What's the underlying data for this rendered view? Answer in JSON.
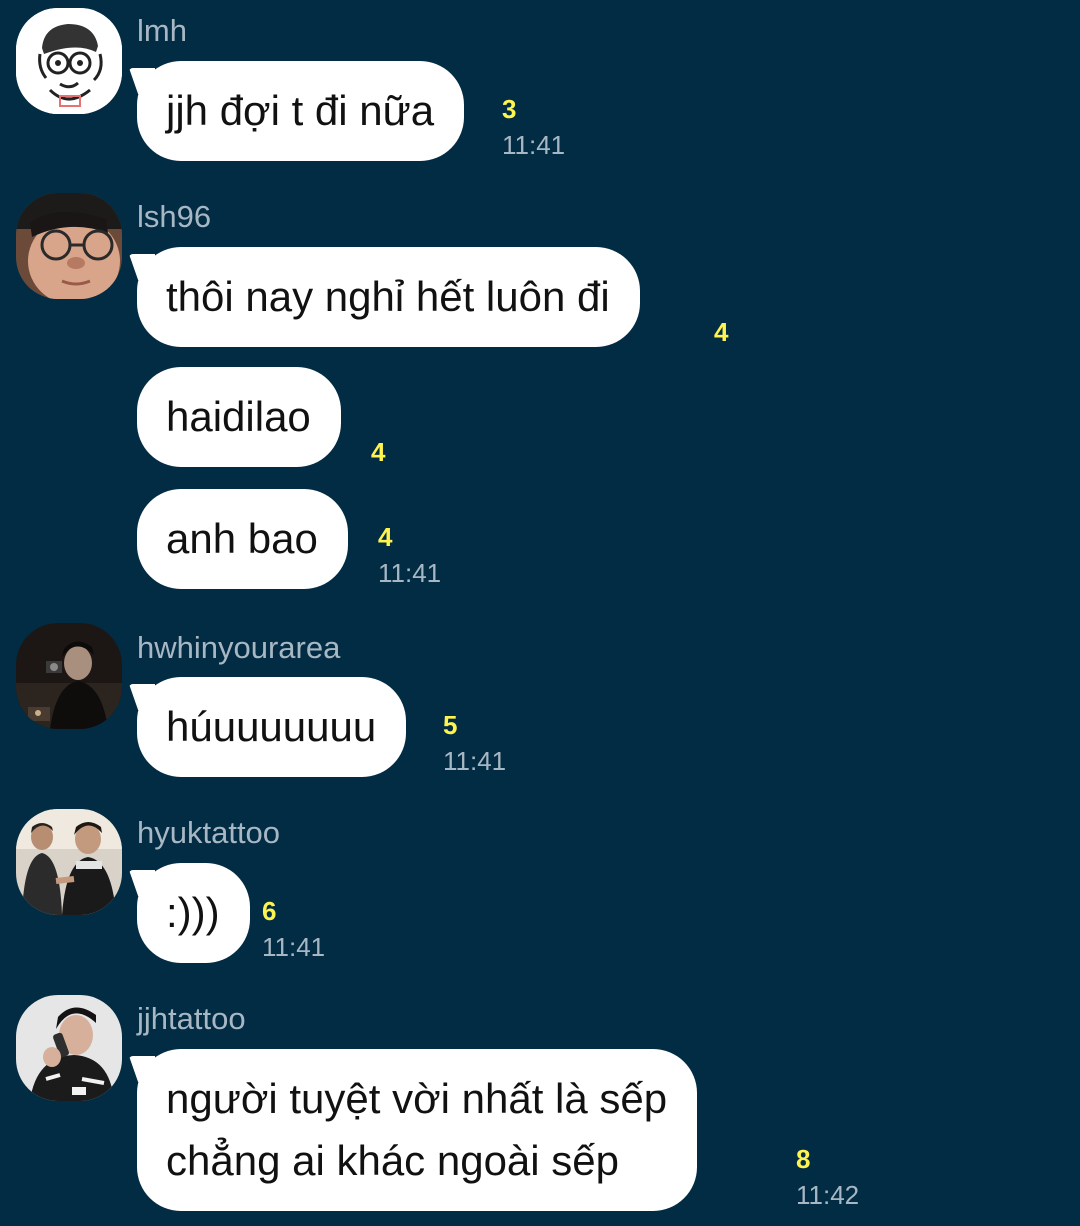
{
  "colors": {
    "background": "#022c43",
    "bubble": "#ffffff",
    "unread_count": "#fff44f",
    "meta_text": "#a7b7c3"
  },
  "messages": [
    {
      "sender": "lmh",
      "avatar": "cartoon-avatar",
      "bubbles": [
        {
          "text": "jjh đợi t đi nữa",
          "unread": "3",
          "time": "11:41"
        }
      ]
    },
    {
      "sender": "lsh96",
      "avatar": "glasses-photo-avatar",
      "bubbles": [
        {
          "text": "thôi nay nghỉ hết luôn đi",
          "unread": "4"
        },
        {
          "text": "haidilao",
          "unread": "4"
        },
        {
          "text": "anh bao",
          "unread": "4",
          "time": "11:41"
        }
      ]
    },
    {
      "sender": "hwhinyourarea",
      "avatar": "dark-photo-avatar",
      "bubbles": [
        {
          "text": "húuuuuuuu",
          "unread": "5",
          "time": "11:41"
        }
      ]
    },
    {
      "sender": "hyuktattoo",
      "avatar": "group-photo-avatar",
      "bubbles": [
        {
          "text": ":)))",
          "unread": "6",
          "time": "11:41"
        }
      ]
    },
    {
      "sender": "jjhtattoo",
      "avatar": "phone-photo-avatar",
      "bubbles": [
        {
          "lines": [
            "người tuyệt vời nhất là sếp",
            "chẳng ai khác ngoài sếp"
          ],
          "unread": "8",
          "time": "11:42"
        }
      ]
    }
  ]
}
